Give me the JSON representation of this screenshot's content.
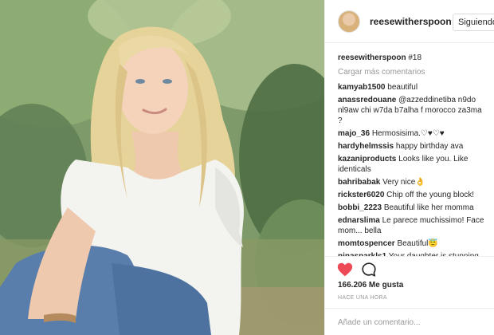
{
  "post": {
    "username": "reesewitherspoon",
    "follow_label": "Siguiendo",
    "caption_user": "reesewitherspoon",
    "caption_text": "#18",
    "load_more": "Cargar más comentarios",
    "likes": "166.206 Me gusta",
    "time_ago": "HACE UNA HORA",
    "comment_placeholder": "Añade un comentario...",
    "liked": true
  },
  "comments": [
    {
      "user": "kamyab1500",
      "text": "beautiful"
    },
    {
      "user": "anassredouane",
      "text": "@azzeddinetiba n9do nl9aw chi w7da b7alha f morocco za3ma ?"
    },
    {
      "user": "majo_36",
      "text": "Hermosisima.♡♥♡♥"
    },
    {
      "user": "hardyhelmssis",
      "text": "happy birthday ava"
    },
    {
      "user": "kazaniproducts",
      "text": "Looks like you. Like identicals"
    },
    {
      "user": "bahribabak",
      "text": "Very nice👌"
    },
    {
      "user": "rickster6020",
      "text": "Chip off the young block!"
    },
    {
      "user": "bobbi_2223",
      "text": "Beautiful like her momma"
    },
    {
      "user": "ednarslima",
      "text": "Le parece muchissimo! Face mom... bella"
    },
    {
      "user": "momtospencer",
      "text": "Beautiful😇"
    },
    {
      "user": "ninasparkls1",
      "text": "Your daughter is stunning"
    }
  ],
  "icons": {
    "like": "heart-icon",
    "comment": "comment-bubble-icon",
    "verified": "verified-badge-icon"
  },
  "colors": {
    "like_red": "#ed4956",
    "verified_blue": "#3897f0",
    "muted_text": "#999999"
  }
}
